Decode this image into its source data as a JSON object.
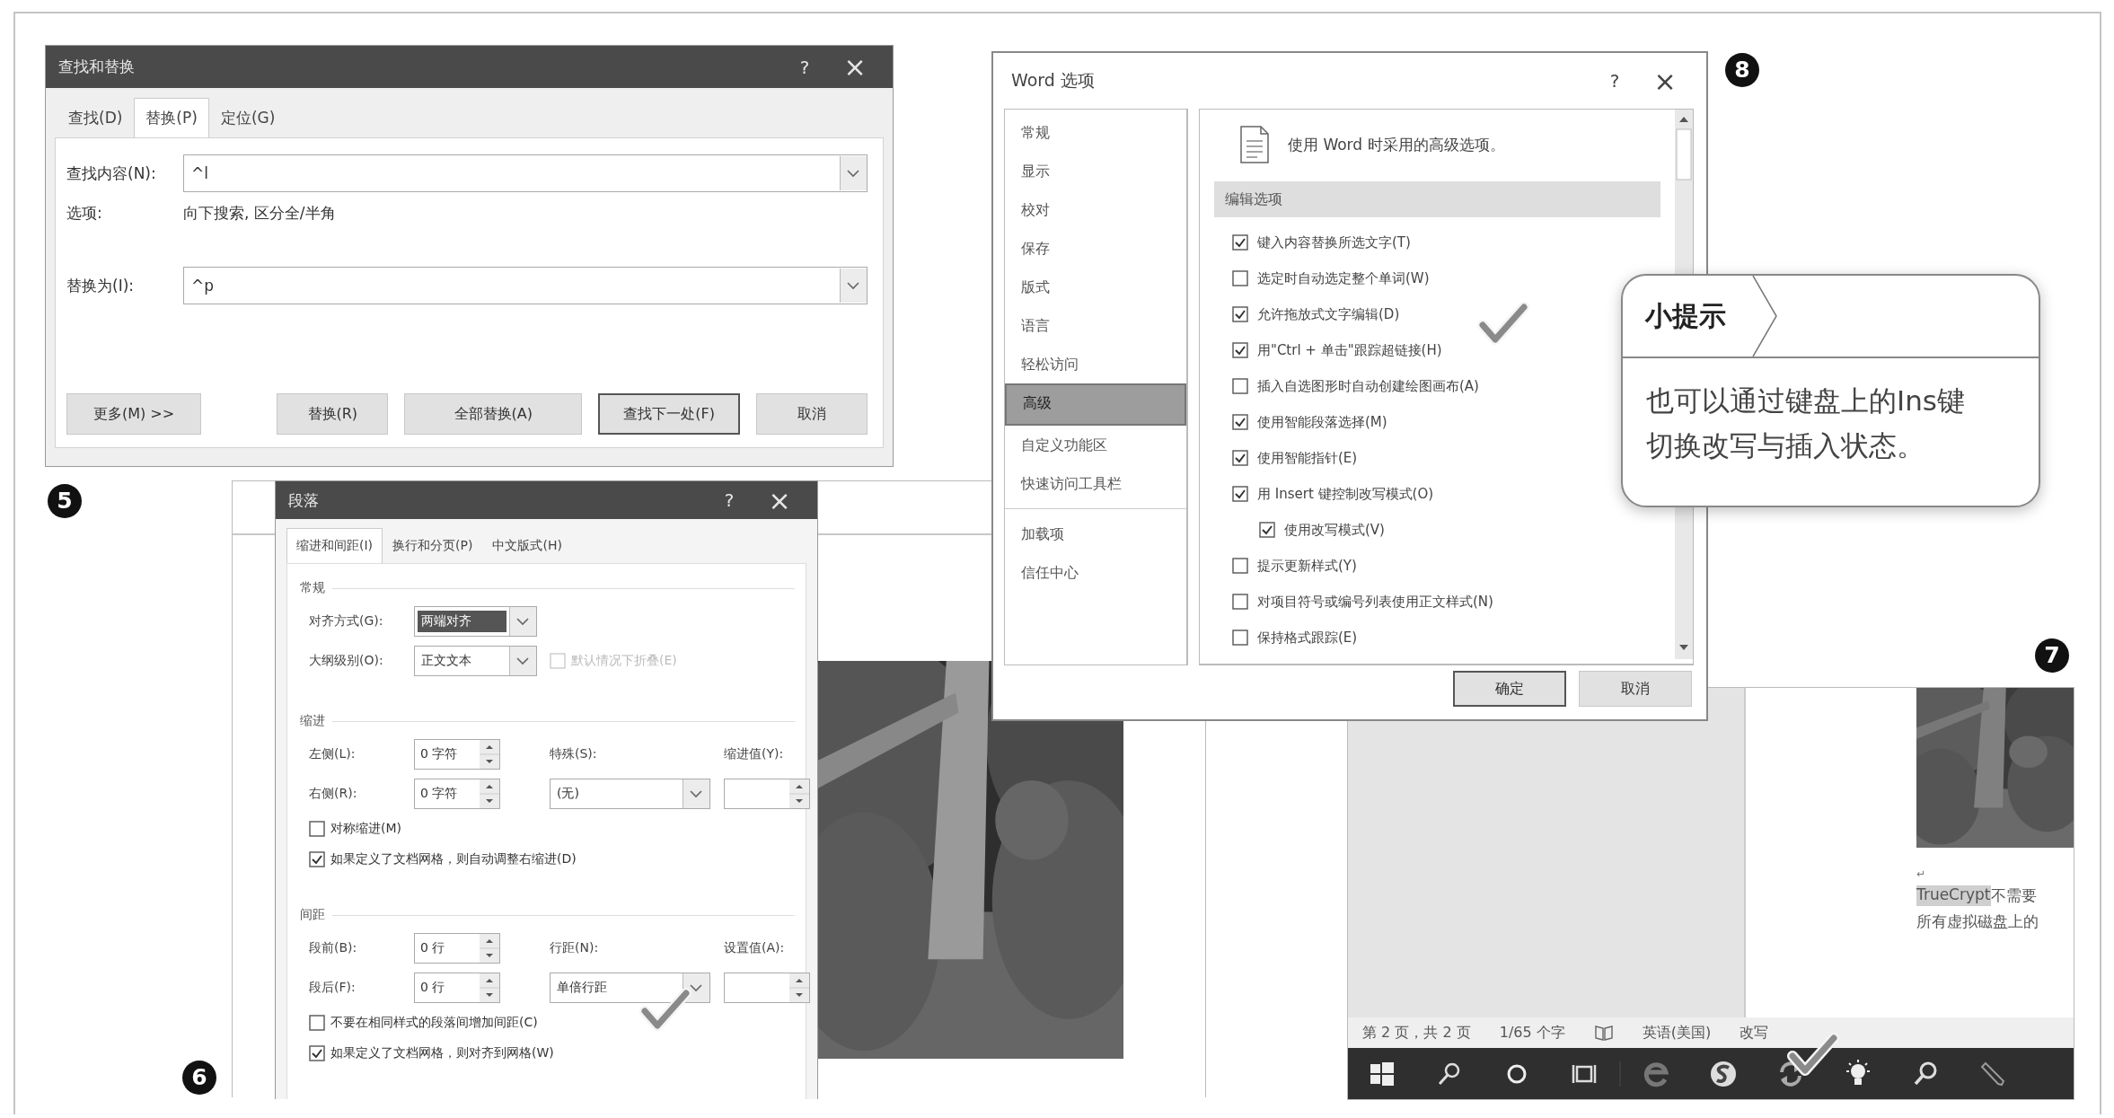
{
  "find_replace": {
    "title": "查找和替换",
    "help": "?",
    "close": "×",
    "callout": "5",
    "tabs": [
      {
        "label": "查找(D)",
        "selected": false
      },
      {
        "label": "替换(P)",
        "selected": true
      },
      {
        "label": "定位(G)",
        "selected": false
      }
    ],
    "find": {
      "label": "查找内容(N):",
      "value": "^l"
    },
    "options": {
      "label": "选项:",
      "value": "向下搜索, 区分全/半角"
    },
    "replace": {
      "label": "替换为(I):",
      "value": "^p"
    },
    "buttons": [
      {
        "label": "更多(M) >>",
        "default": false
      },
      {
        "label": "替换(R)",
        "default": false
      },
      {
        "label": "全部替换(A)",
        "default": false
      },
      {
        "label": "查找下一处(F)",
        "default": true
      },
      {
        "label": "取消",
        "default": false
      }
    ]
  },
  "paragraph": {
    "title": "段落",
    "help": "?",
    "close": "×",
    "callout": "6",
    "tabs": [
      {
        "label": "缩进和间距(I)",
        "selected": true
      },
      {
        "label": "换行和分页(P)",
        "selected": false
      },
      {
        "label": "中文版式(H)",
        "selected": false
      }
    ],
    "sections": [
      {
        "heading": "常规",
        "rows": [
          [
            {
              "kind": "label",
              "text": "对齐方式(G):"
            },
            {
              "kind": "dropdown",
              "value": "两端对齐",
              "highlighted": true
            }
          ],
          [
            {
              "kind": "label",
              "text": "大纲级别(O):"
            },
            {
              "kind": "dropdown",
              "value": "正文文本",
              "highlighted": false
            },
            {
              "kind": "checkbox",
              "label": "默认情况下折叠(E)",
              "checked": false,
              "disabled": true
            }
          ]
        ]
      },
      {
        "heading": "缩进",
        "rows": [
          [
            {
              "kind": "label",
              "text": "左侧(L):"
            },
            {
              "kind": "spinner",
              "value": "0 字符"
            },
            {
              "kind": "label",
              "text": "特殊(S):"
            },
            {
              "kind": "label",
              "text": "缩进值(Y):"
            }
          ],
          [
            {
              "kind": "label",
              "text": "右侧(R):"
            },
            {
              "kind": "spinner",
              "value": "0 字符"
            },
            {
              "kind": "dropdown",
              "value": "(无)",
              "highlighted": false
            },
            {
              "kind": "spinner"
            }
          ],
          [
            {
              "kind": "checkbox",
              "label": "对称缩进(M)",
              "checked": false,
              "disabled": false
            }
          ],
          [
            {
              "kind": "checkbox",
              "label": "如果定义了文档网格，则自动调整右缩进(D)",
              "checked": true,
              "disabled": false
            }
          ]
        ]
      },
      {
        "heading": "间距",
        "rows": [
          [
            {
              "kind": "label",
              "text": "段前(B):"
            },
            {
              "kind": "spinner",
              "value": "0 行"
            },
            {
              "kind": "label",
              "text": "行距(N):"
            },
            {
              "kind": "label",
              "text": "设置值(A):"
            }
          ],
          [
            {
              "kind": "label",
              "text": "段后(F):"
            },
            {
              "kind": "spinner",
              "value": "0 行"
            },
            {
              "kind": "dropdown",
              "value": "单倍行距",
              "highlighted": false
            },
            {
              "kind": "spinner"
            }
          ],
          [
            {
              "kind": "checkbox",
              "label": "不要在相同样式的段落间增加间距(C)",
              "checked": false,
              "disabled": false
            }
          ],
          [
            {
              "kind": "checkbox",
              "label": "如果定义了文档网格，则对齐到网格(W)",
              "checked": true,
              "disabled": false
            }
          ]
        ]
      }
    ]
  },
  "word_options": {
    "title": "Word 选项",
    "help": "?",
    "close": "×",
    "callout": "8",
    "nav_groups": [
      [
        {
          "label": "常规",
          "selected": false
        },
        {
          "label": "显示",
          "selected": false
        },
        {
          "label": "校对",
          "selected": false
        },
        {
          "label": "保存",
          "selected": false
        },
        {
          "label": "版式",
          "selected": false
        },
        {
          "label": "语言",
          "selected": false
        },
        {
          "label": "轻松访问",
          "selected": false
        },
        {
          "label": "高级",
          "selected": true
        },
        {
          "label": "自定义功能区",
          "selected": false
        },
        {
          "label": "快速访问工具栏",
          "selected": false
        }
      ],
      [
        {
          "label": "加载项",
          "selected": false
        },
        {
          "label": "信任中心",
          "selected": false
        }
      ]
    ],
    "heading": "使用 Word 时采用的高级选项。",
    "section": "编辑选项",
    "options": [
      {
        "label": "键入内容替换所选文字(T)",
        "checked": true
      },
      {
        "label": "选定时自动选定整个单词(W)",
        "checked": false
      },
      {
        "label": "允许拖放式文字编辑(D)",
        "checked": true
      },
      {
        "label": "用\"Ctrl + 单击\"跟踪超链接(H)",
        "checked": true
      },
      {
        "label": "插入自选图形时自动创建绘图画布(A)",
        "checked": false
      },
      {
        "label": "使用智能段落选择(M)",
        "checked": true
      },
      {
        "label": "使用智能指针(E)",
        "checked": true
      },
      {
        "label": "用 Insert 键控制改写模式(O)",
        "checked": true,
        "children": [
          {
            "label": "使用改写模式(V)",
            "checked": true
          }
        ]
      },
      {
        "label": "提示更新样式(Y)",
        "checked": false
      },
      {
        "label": "对项目符号或编号列表使用正文样式(N)",
        "checked": false
      },
      {
        "label": "保持格式跟踪(E)",
        "checked": false
      }
    ],
    "buttons": [
      {
        "label": "确定",
        "default": true
      },
      {
        "label": "取消",
        "default": false
      }
    ]
  },
  "tip": {
    "title": "小提示",
    "text": "也可以通过键盘上的Ins键切换改写与插入状态。"
  },
  "word_window": {
    "callout": "7",
    "paragraph_mark": "↵",
    "lines": [
      [
        {
          "text": "TrueCrypt",
          "highlighted": true
        },
        {
          "text": "不需要",
          "highlighted": false
        }
      ],
      [
        {
          "text": "所有虚拟磁盘上的",
          "highlighted": false
        }
      ]
    ],
    "status": [
      "第 2 页，共 2 页",
      "1/65 个字",
      "英语(美国)",
      "改写"
    ]
  }
}
